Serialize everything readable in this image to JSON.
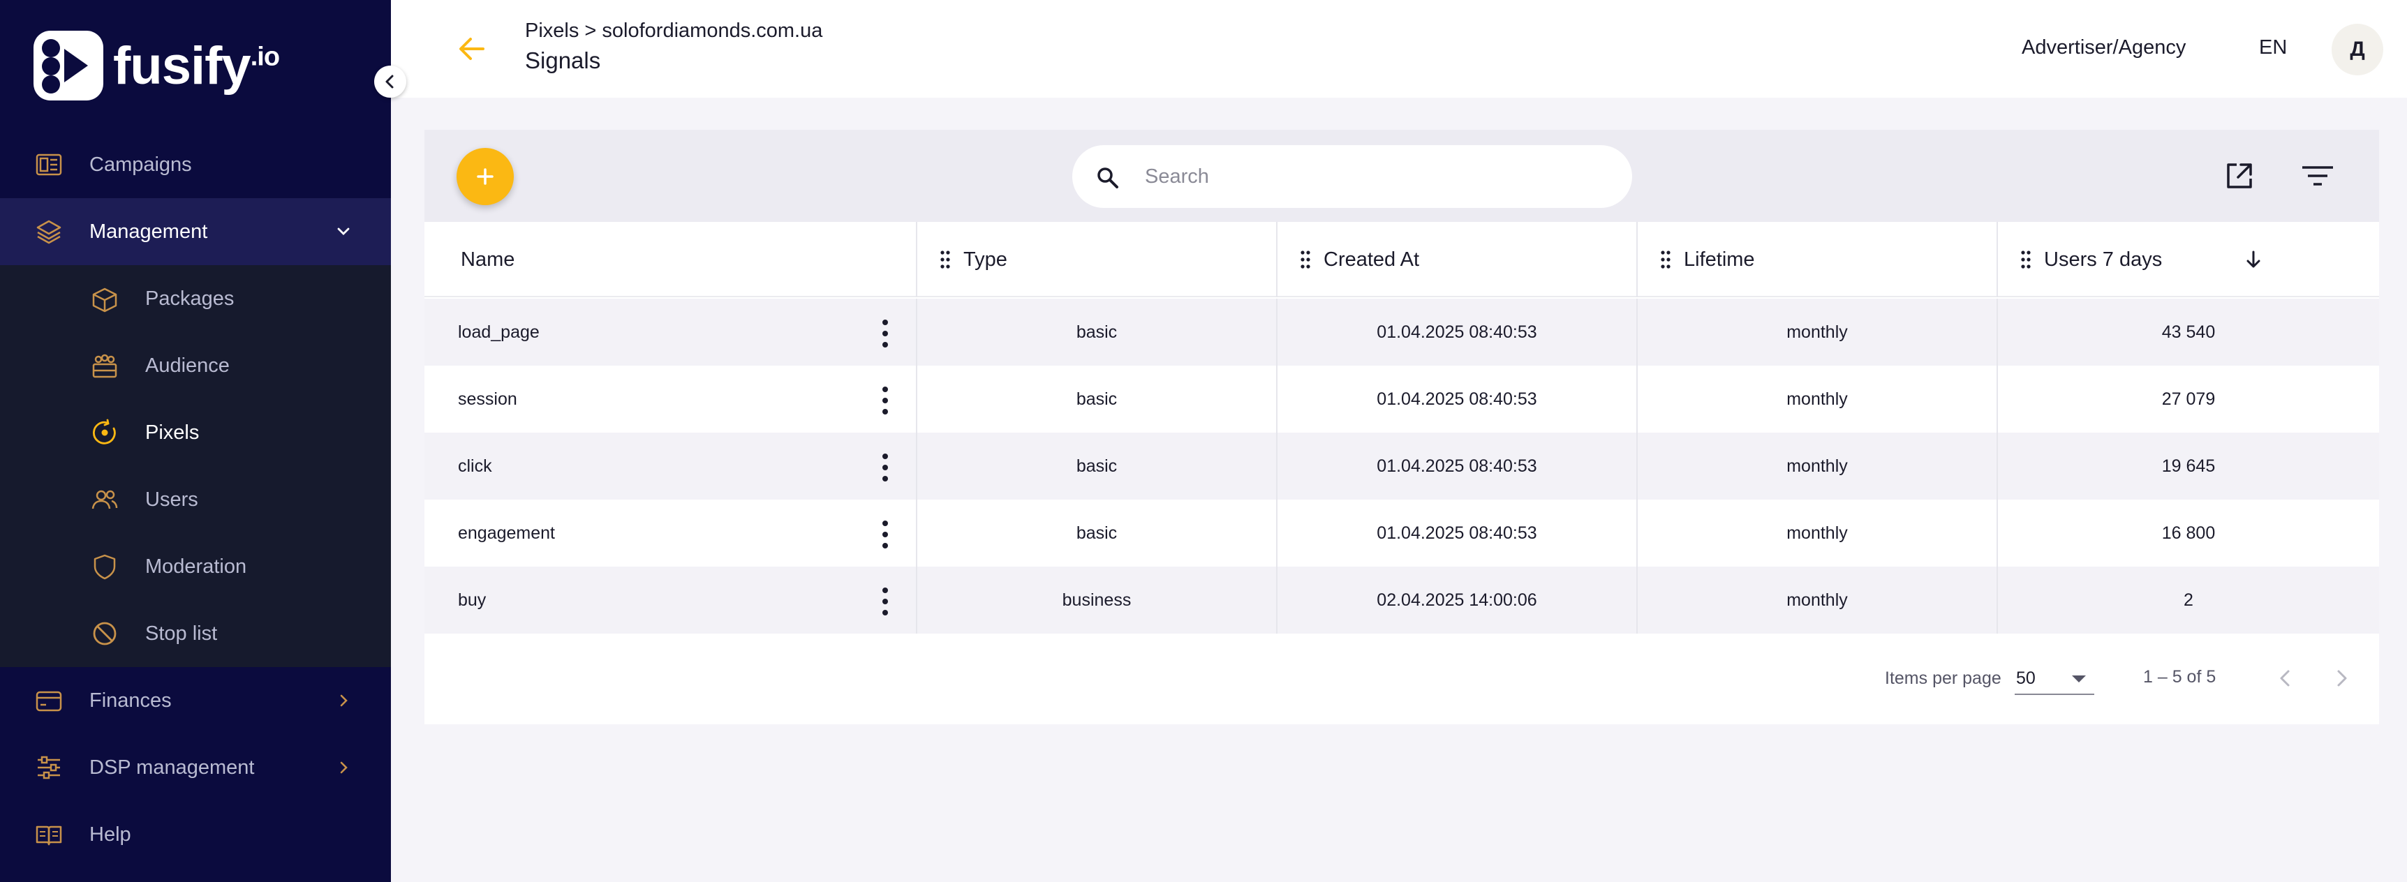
{
  "brand": {
    "name": "fusify",
    "suffix": ".io"
  },
  "colors": {
    "sidebar_bg": "#0b0b3e",
    "accent": "#fbb813",
    "icon": "#c8924a"
  },
  "sidebar": {
    "items": [
      {
        "label": "Campaigns",
        "icon": "dashboard-icon"
      },
      {
        "label": "Management",
        "icon": "layers-icon",
        "expanded": true
      },
      {
        "label": "Packages",
        "icon": "package-icon"
      },
      {
        "label": "Audience",
        "icon": "audience-icon"
      },
      {
        "label": "Pixels",
        "icon": "pixel-target-icon",
        "active": true
      },
      {
        "label": "Users",
        "icon": "users-icon"
      },
      {
        "label": "Moderation",
        "icon": "shield-icon"
      },
      {
        "label": "Stop list",
        "icon": "block-icon"
      },
      {
        "label": "Finances",
        "icon": "wallet-icon"
      },
      {
        "label": "DSP management",
        "icon": "sliders-icon"
      },
      {
        "label": "Help",
        "icon": "book-icon"
      }
    ]
  },
  "header": {
    "breadcrumb_parent": "Pixels",
    "breadcrumb_sep": ">",
    "breadcrumb_current": "solofordiamonds.com.ua",
    "title": "Signals",
    "role": "Advertiser/Agency",
    "lang": "EN",
    "avatar_initial": "Д"
  },
  "search": {
    "placeholder": "Search",
    "value": ""
  },
  "table": {
    "columns": [
      "Name",
      "Type",
      "Created At",
      "Lifetime",
      "Users 7 days"
    ],
    "rows": [
      {
        "name": "load_page",
        "type": "basic",
        "created": "01.04.2025 08:40:53",
        "lifetime": "monthly",
        "users": "43 540"
      },
      {
        "name": "session",
        "type": "basic",
        "created": "01.04.2025 08:40:53",
        "lifetime": "monthly",
        "users": "27 079"
      },
      {
        "name": "click",
        "type": "basic",
        "created": "01.04.2025 08:40:53",
        "lifetime": "monthly",
        "users": "19 645"
      },
      {
        "name": "engagement",
        "type": "basic",
        "created": "01.04.2025 08:40:53",
        "lifetime": "monthly",
        "users": "16 800"
      },
      {
        "name": "buy",
        "type": "business",
        "created": "02.04.2025 14:00:06",
        "lifetime": "monthly",
        "users": "2"
      }
    ]
  },
  "pager": {
    "items_per_page_label": "Items per page",
    "items_per_page": "50",
    "range": "1 – 5 of 5"
  }
}
